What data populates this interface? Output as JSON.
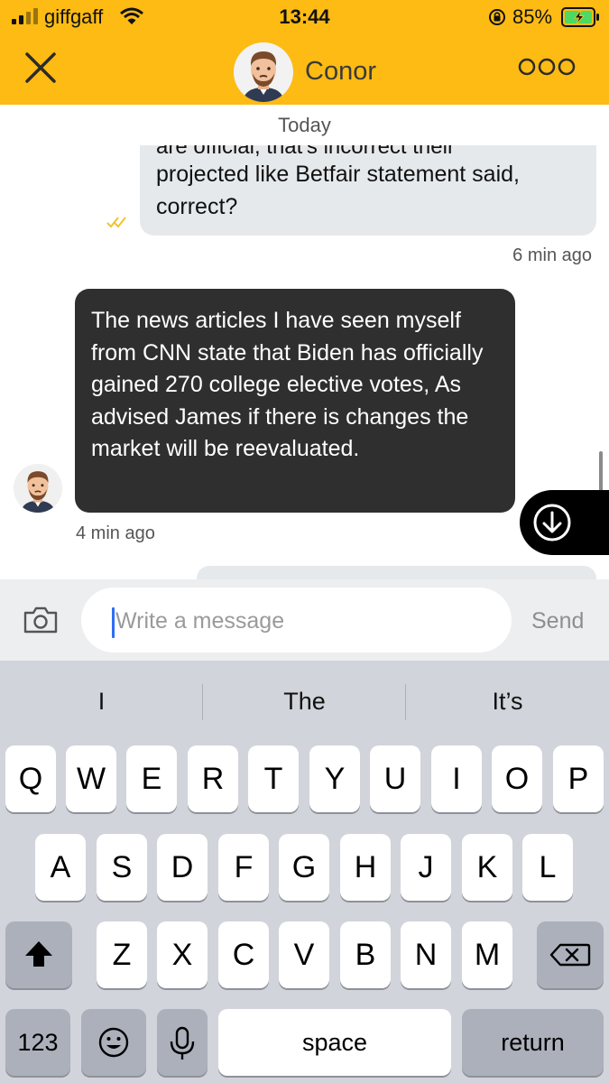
{
  "status_bar": {
    "carrier": "giffgaff",
    "time": "13:44",
    "battery": "85%"
  },
  "header": {
    "contact_name": "Conor",
    "accent_color": "#fdbb13"
  },
  "chat": {
    "date_separator": "Today",
    "messages": [
      {
        "direction": "outgoing",
        "clipped_line": "are official, that's incorrect their",
        "text": "projected like Betfair statement said, correct?",
        "time": "6 min ago"
      },
      {
        "direction": "incoming",
        "text": "The news articles I have seen myself from CNN state that Biden has officially gained 270 college elective votes, As advised James if there is changes the market will be reevaluated.",
        "time": "4 min ago"
      }
    ]
  },
  "composer": {
    "placeholder": "Write a message",
    "send_label": "Send"
  },
  "keyboard": {
    "suggestions": [
      "I",
      "The",
      "It’s"
    ],
    "rows": [
      [
        "Q",
        "W",
        "E",
        "R",
        "T",
        "Y",
        "U",
        "I",
        "O",
        "P"
      ],
      [
        "A",
        "S",
        "D",
        "F",
        "G",
        "H",
        "J",
        "K",
        "L"
      ],
      [
        "Z",
        "X",
        "C",
        "V",
        "B",
        "N",
        "M"
      ]
    ],
    "numbers_label": "123",
    "space_label": "space",
    "return_label": "return"
  },
  "icons": [
    "close-icon",
    "more-icon",
    "camera-icon",
    "scroll-down-icon",
    "shift-icon",
    "backspace-icon",
    "emoji-icon",
    "microphone-icon",
    "signal-icon",
    "wifi-icon",
    "battery-icon",
    "orientation-lock-icon",
    "read-ticks-icon"
  ]
}
